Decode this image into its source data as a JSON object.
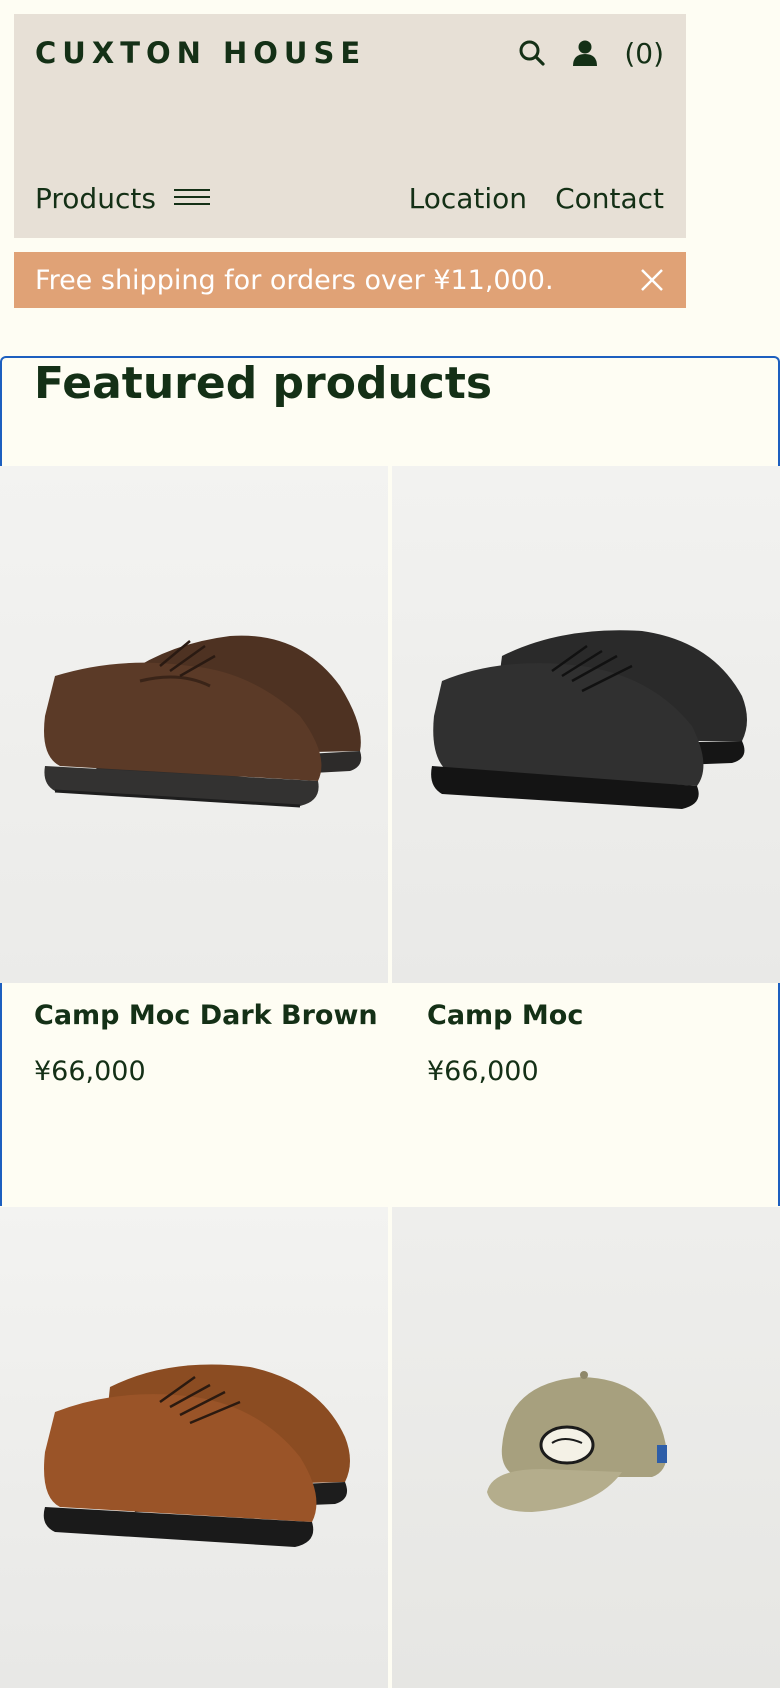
{
  "header": {
    "logo": "CUXTON HOUSE",
    "cart_count": "(0)",
    "nav_products": "Products",
    "nav_location": "Location",
    "nav_contact": "Contact"
  },
  "banner": {
    "text": "Free shipping for orders over ¥11,000."
  },
  "featured": {
    "title": "Featured products",
    "products": [
      {
        "name": "Camp Moc Dark Brown",
        "price": "¥66,000"
      },
      {
        "name": "Camp Moc",
        "price": "¥66,000"
      },
      {
        "name": "",
        "price": ""
      },
      {
        "name": "",
        "price": ""
      }
    ]
  },
  "colors": {
    "background": "#fefdf3",
    "header_bg": "#e7e0d6",
    "banner_bg": "#e0a276",
    "text": "#143016",
    "focus_outline": "#1d5fbf"
  },
  "icons": [
    "search-icon",
    "account-icon",
    "menu-icon",
    "close-icon"
  ]
}
